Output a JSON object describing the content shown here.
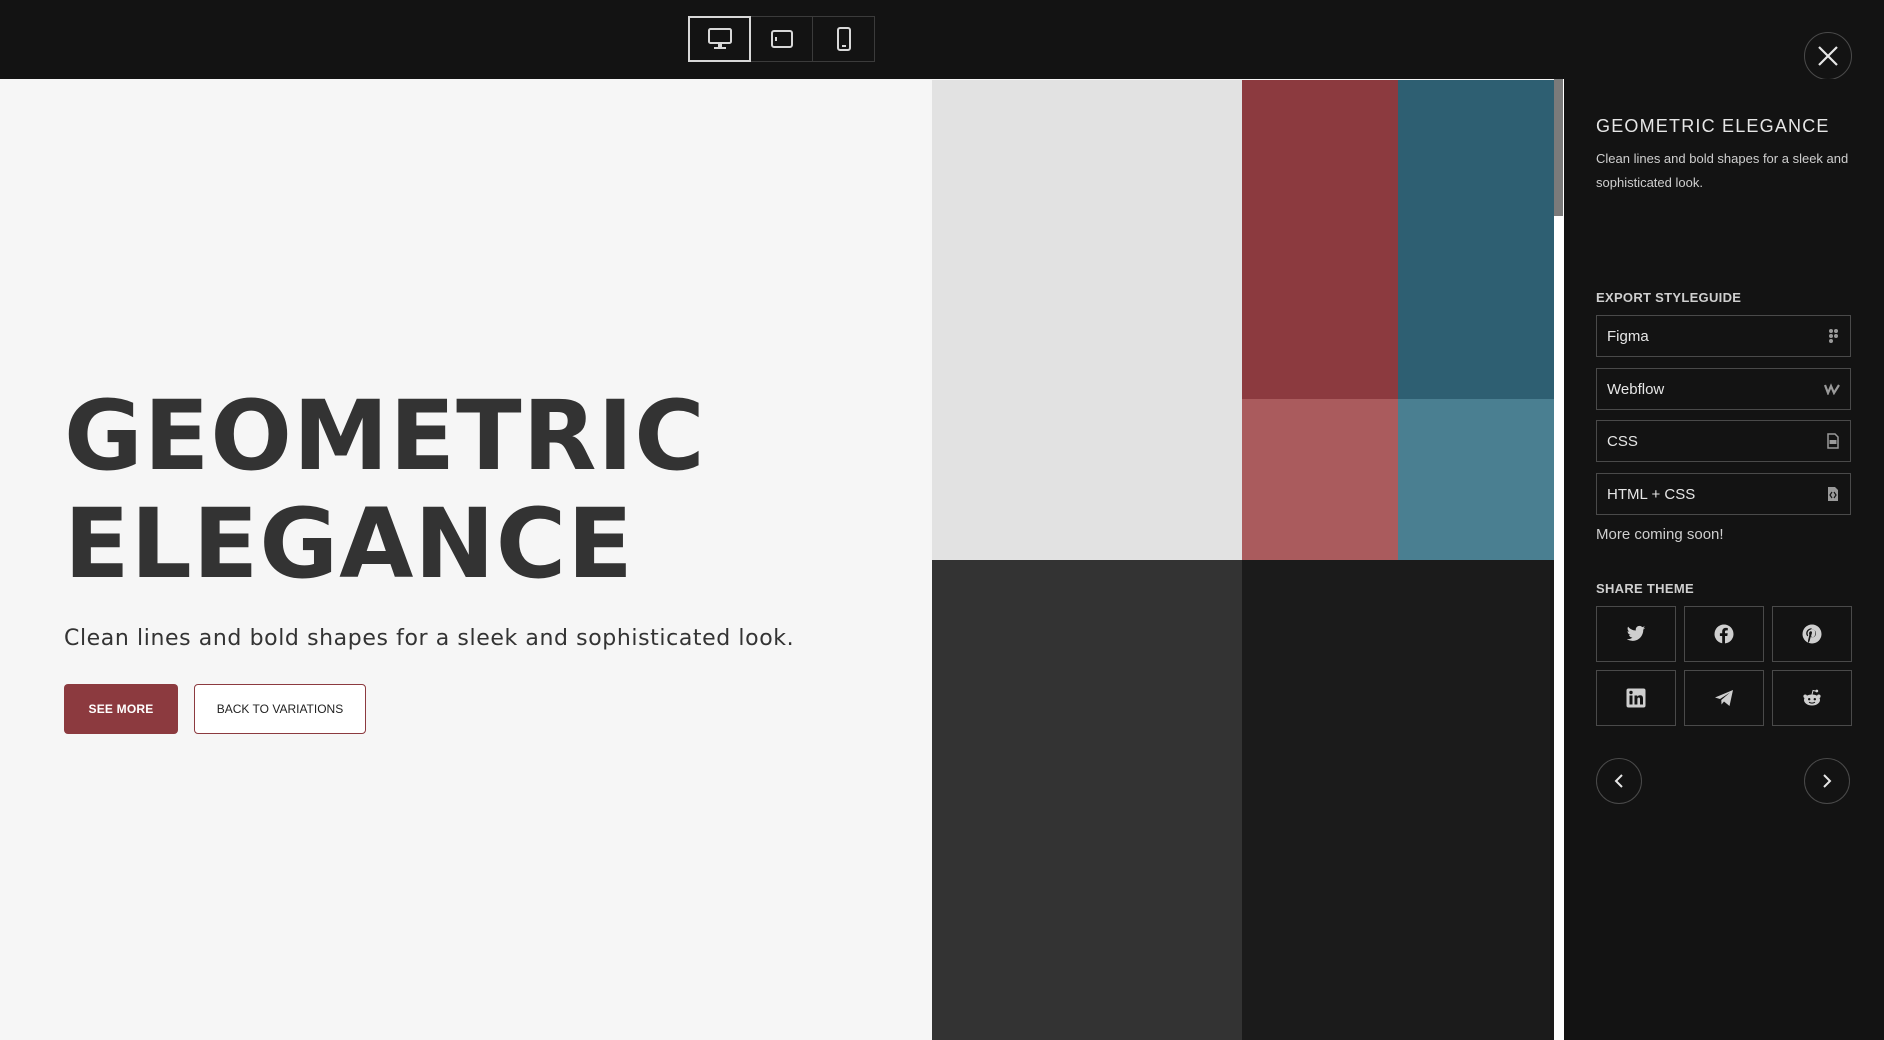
{
  "devices": [
    {
      "name": "desktop-icon",
      "active": true
    },
    {
      "name": "tablet-icon",
      "active": false
    },
    {
      "name": "mobile-icon",
      "active": false
    }
  ],
  "hero": {
    "title_line1": "GEOMETRIC",
    "title_line2": "ELEGANCE",
    "subtitle": "Clean lines and bold shapes for a sleek and sophisticated look.",
    "primary_button": "SEE MORE",
    "secondary_button": "BACK TO VARIATIONS"
  },
  "palette": {
    "light_gray": "#e2e2e2",
    "dark_red": "#8c3a3f",
    "dark_teal": "#2e5f72",
    "light_red": "#aa5b5d",
    "light_teal": "#4a7f91",
    "charcoal": "#333333",
    "near_black": "#1b1b1b",
    "primary": "#8c3a3f",
    "text": "#333333"
  },
  "panel": {
    "title": "GEOMETRIC ELEGANCE",
    "description": "Clean lines and bold shapes for a sleek and sophisticated look.",
    "export_heading": "EXPORT STYLEGUIDE",
    "export_items": [
      {
        "label": "Figma",
        "icon": "figma-icon"
      },
      {
        "label": "Webflow",
        "icon": "webflow-icon"
      },
      {
        "label": "CSS",
        "icon": "css-file-icon"
      },
      {
        "label": "HTML + CSS",
        "icon": "html-file-icon"
      }
    ],
    "more_soon": "More coming soon!",
    "share_heading": "SHARE THEME",
    "share_items": [
      "twitter-icon",
      "facebook-icon",
      "pinterest-icon",
      "linkedin-icon",
      "telegram-icon",
      "reddit-icon"
    ]
  }
}
